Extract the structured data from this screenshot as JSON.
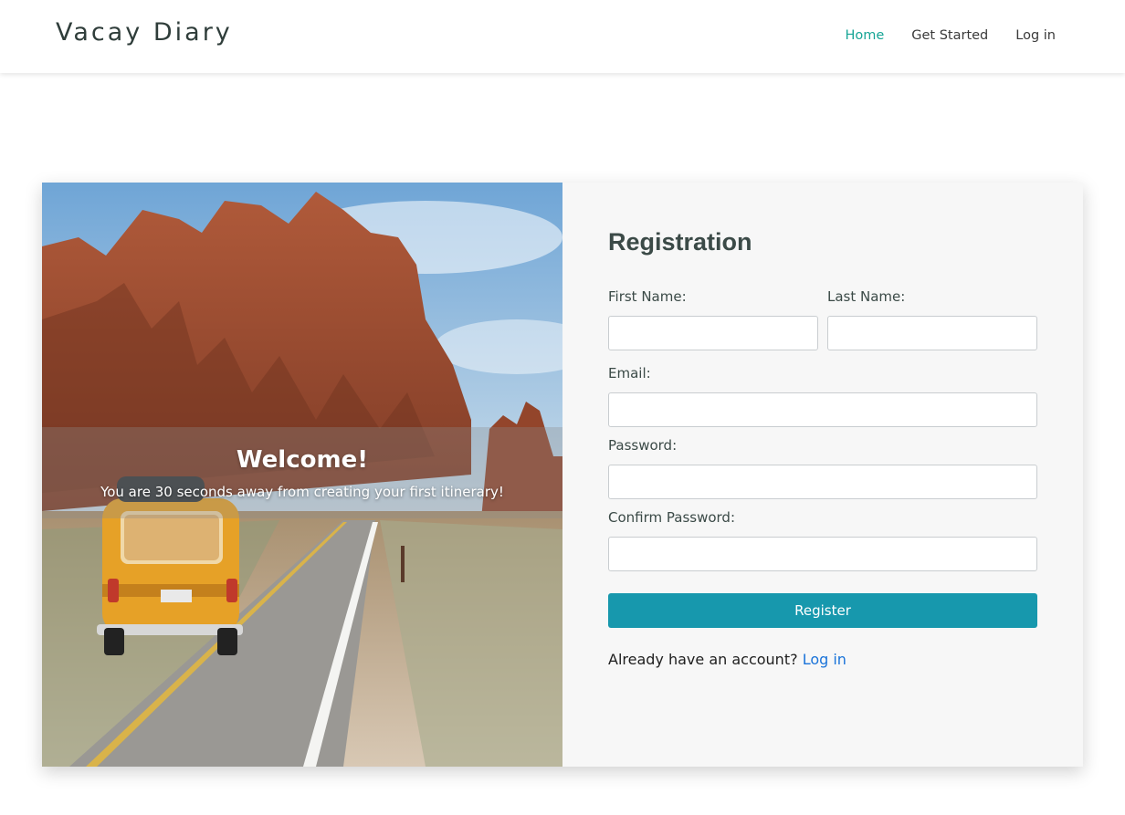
{
  "header": {
    "brand": "Vacay Diary",
    "nav": [
      {
        "label": "Home"
      },
      {
        "label": "Get Started"
      },
      {
        "label": "Log in"
      }
    ],
    "active_color": "#17a596"
  },
  "hero": {
    "title": "Welcome!",
    "subtitle": "You are 30 seconds away from creating your first itinerary!"
  },
  "form": {
    "title": "Registration",
    "first_name_label": "First Name:",
    "last_name_label": "Last Name:",
    "email_label": "Email:",
    "password_label": "Password:",
    "confirm_password_label": "Confirm Password:",
    "first_name_value": "",
    "last_name_value": "",
    "email_value": "",
    "password_value": "",
    "confirm_password_value": "",
    "register_label": "Register",
    "register_color": "#1798ad",
    "login_prompt": "Already have an account?",
    "login_link": "Log in",
    "link_color": "#1a73d9"
  }
}
